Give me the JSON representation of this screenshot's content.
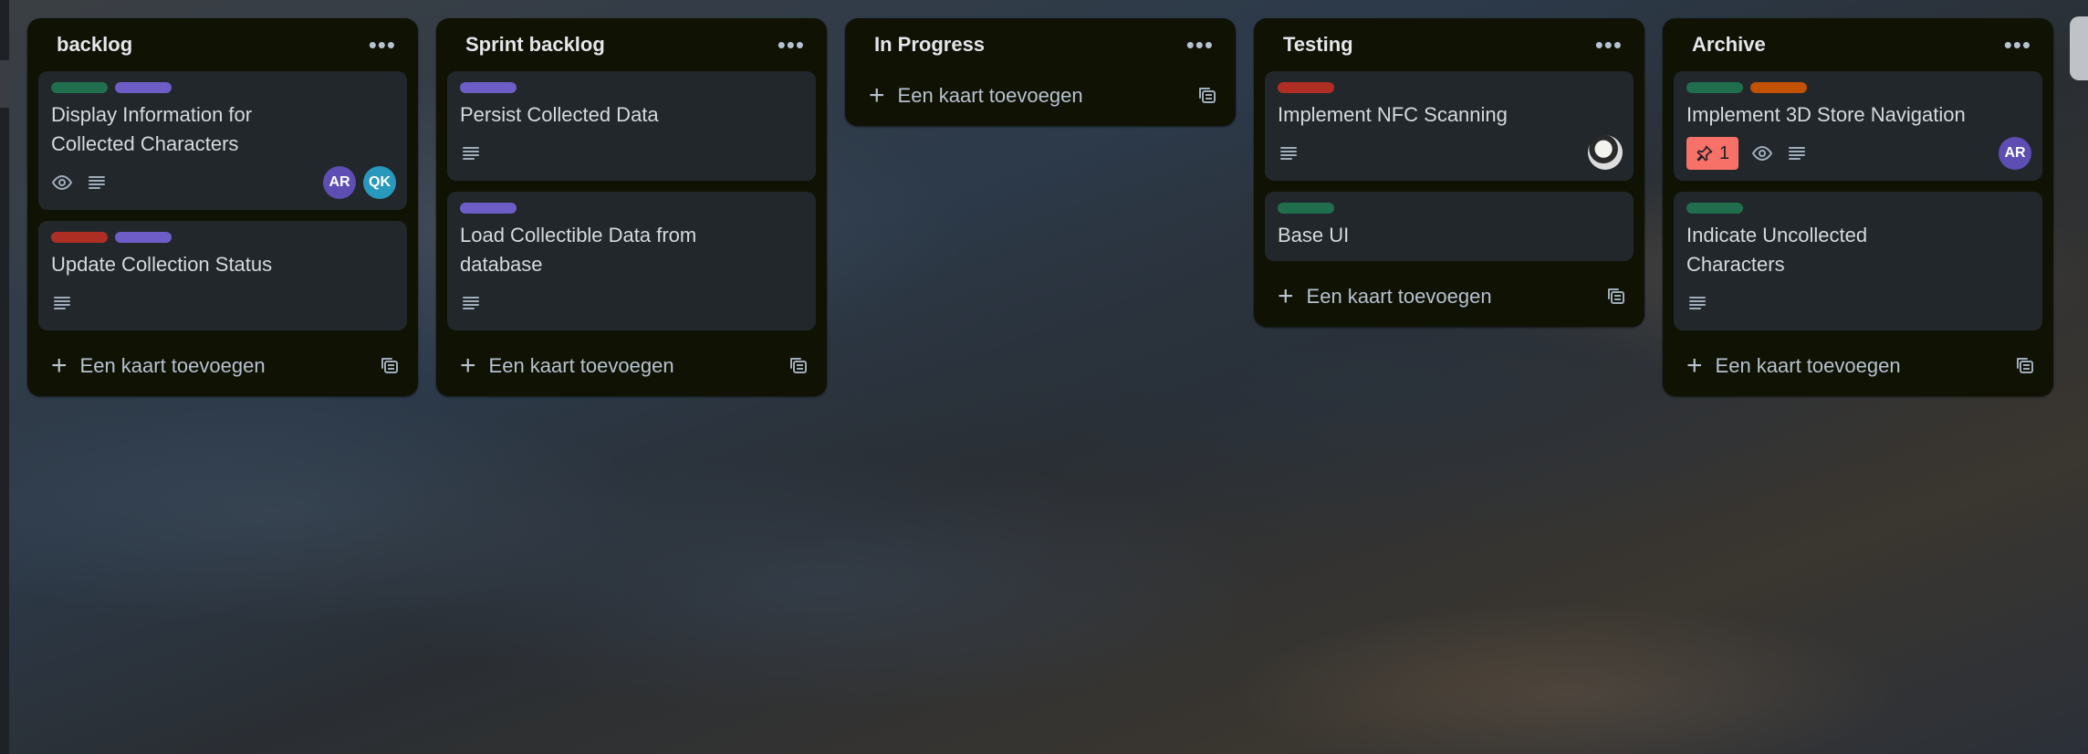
{
  "lists": [
    {
      "title": "backlog",
      "add_label": "Een kaart toevoegen",
      "cards": [
        {
          "title": "Display Information for Collected Characters",
          "labels": [
            "#216e4e",
            "#6e5dc6"
          ],
          "badges": [
            "eye-icon",
            "description-icon"
          ],
          "members": [
            {
              "initials": "AR",
              "color": "#5e4db2"
            },
            {
              "initials": "QK",
              "color": "#2898bd"
            }
          ]
        },
        {
          "title": "Update Collection Status",
          "labels": [
            "#ae2e24",
            "#6e5dc6"
          ],
          "badges": [
            "description-icon"
          ]
        }
      ]
    },
    {
      "title": "Sprint backlog",
      "add_label": "Een kaart toevoegen",
      "cards": [
        {
          "title": "Persist Collected Data",
          "labels": [
            "#6e5dc6"
          ],
          "badges": [
            "description-icon"
          ]
        },
        {
          "title": "Load Collectible Data from database",
          "labels": [
            "#6e5dc6"
          ],
          "badges": [
            "description-icon"
          ]
        }
      ]
    },
    {
      "title": "In Progress",
      "add_label": "Een kaart toevoegen",
      "cards": []
    },
    {
      "title": "Testing",
      "add_label": "Een kaart toevoegen",
      "cards": [
        {
          "title": "Implement NFC Scanning",
          "labels": [
            "#ae2e24"
          ],
          "badges": [
            "description-icon"
          ],
          "member_photo": true
        },
        {
          "title": "Base UI",
          "labels": [
            "#216e4e"
          ],
          "badges": []
        }
      ]
    },
    {
      "title": "Archive",
      "add_label": "Een kaart toevoegen",
      "cards": [
        {
          "title": "Implement 3D Store Navigation",
          "labels": [
            "#216e4e",
            "#c25100"
          ],
          "alert": "1",
          "badges": [
            "eye-icon",
            "description-icon"
          ],
          "members": [
            {
              "initials": "AR",
              "color": "#5e4db2"
            }
          ]
        },
        {
          "title": "Indicate Uncollected Characters",
          "labels": [
            "#216e4e"
          ],
          "badges": [
            "description-icon"
          ]
        }
      ]
    }
  ]
}
